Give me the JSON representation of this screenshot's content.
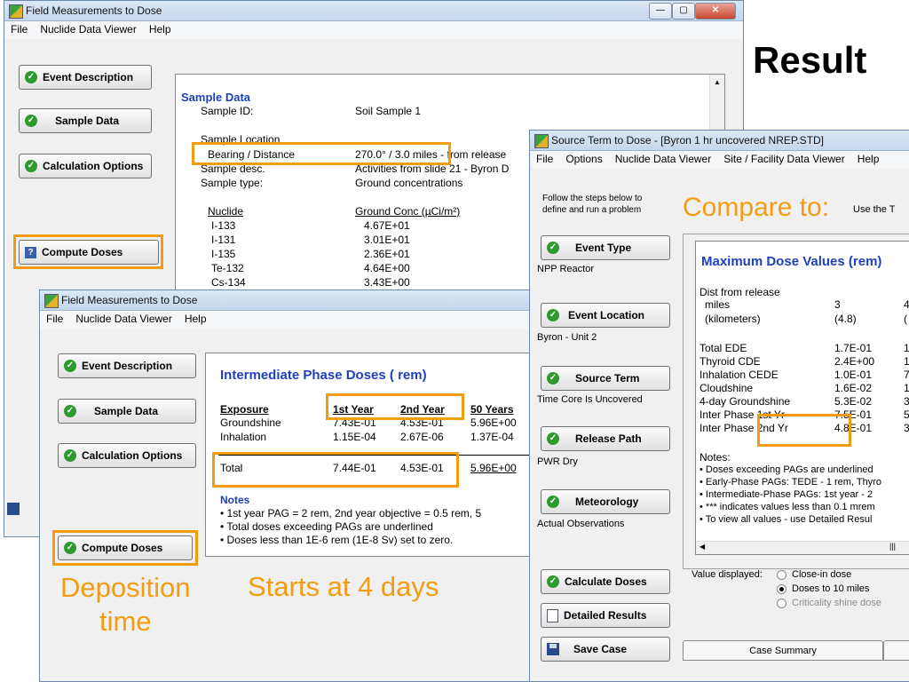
{
  "slide": {
    "heading": "Result",
    "compare": "Compare to:",
    "deposition": "Deposition\ntime",
    "starts": "Starts at 4 days"
  },
  "win1": {
    "title": "Field Measurements to Dose",
    "menu": [
      "File",
      "Nuclide Data Viewer",
      "Help"
    ],
    "buttons": {
      "event_description": "Event Description",
      "sample_data": "Sample Data",
      "calculation_options": "Calculation Options",
      "compute_doses": "Compute Doses"
    },
    "sample": {
      "heading": "Sample Data",
      "rows": [
        {
          "label": "Sample ID:",
          "value": "Soil Sample 1"
        },
        {
          "label": "Sample Location",
          "value": ""
        },
        {
          "label": "Bearing / Distance",
          "value": "270.0° / 3.0 miles - from release"
        },
        {
          "label": "Sample desc.",
          "value": "Activities from slide 21 - Byron D"
        },
        {
          "label": "Sample type:",
          "value": "Ground concentrations"
        }
      ],
      "nuclide_header": "Nuclide",
      "conc_header": "Ground Conc (µCi/m²)",
      "nuclides": [
        {
          "name": "I-133",
          "conc": "4.67E+01"
        },
        {
          "name": "I-131",
          "conc": "3.01E+01"
        },
        {
          "name": "I-135",
          "conc": "2.36E+01"
        },
        {
          "name": "Te-132",
          "conc": "4.64E+00"
        },
        {
          "name": "Cs-134",
          "conc": "3.43E+00"
        }
      ]
    }
  },
  "win2": {
    "title": "Field Measurements to Dose",
    "menu": [
      "File",
      "Nuclide Data Viewer",
      "Help"
    ],
    "buttons": {
      "event_description": "Event Description",
      "sample_data": "Sample Data",
      "calculation_options": "Calculation Options",
      "compute_doses": "Compute Doses"
    },
    "table": {
      "heading": "Intermediate Phase Doses ( rem)",
      "headers": [
        "Exposure",
        "1st Year",
        "2nd Year",
        "50 Years"
      ],
      "rows": [
        [
          "Groundshine",
          "7.43E-01",
          "4.53E-01",
          "5.96E+00"
        ],
        [
          "Inhalation",
          "1.15E-04",
          "2.67E-06",
          "1.37E-04"
        ]
      ],
      "total": [
        "Total",
        "7.44E-01",
        "4.53E-01",
        "5.96E+00"
      ]
    },
    "notes": {
      "heading": "Notes",
      "lines": [
        "• 1st year PAG = 2 rem, 2nd year objective = 0.5 rem, 5",
        "• Total doses exceeding PAGs are underlined",
        "• Doses less than 1E-6 rem (1E-8 Sv) set to zero."
      ]
    }
  },
  "win3": {
    "title": "Source Term to Dose - [Byron 1 hr uncovered NREP.STD]",
    "menu": [
      "File",
      "Options",
      "Nuclide Data Viewer",
      "Site / Facility Data Viewer",
      "Help"
    ],
    "intro": "Follow the steps below to\ndefine and run a problem",
    "use_the": "Use the T",
    "steps": [
      {
        "label": "Event Type",
        "sub": "NPP Reactor"
      },
      {
        "label": "Event Location",
        "sub": "Byron - Unit 2"
      },
      {
        "label": "Source Term",
        "sub": "Time Core Is Uncovered"
      },
      {
        "label": "Release Path",
        "sub": "PWR Dry"
      },
      {
        "label": "Meteorology",
        "sub": "Actual Observations"
      }
    ],
    "calculate_doses": "Calculate Doses",
    "detailed_results": "Detailed Results",
    "save_case": "Save Case",
    "results": {
      "heading": "Maximum Dose Values (rem)",
      "dist_label": "Dist from release",
      "miles_label": "miles",
      "miles_value": "3",
      "km_label": "(kilometers)",
      "km_value": "(4.8)",
      "col2_miles": "4",
      "col2_km": "(",
      "rows": [
        {
          "label": "Total EDE",
          "v1": "1.7E-01",
          "v2": "1"
        },
        {
          "label": "Thyroid CDE",
          "v1": "2.4E+00",
          "v2": "1"
        },
        {
          "label": "Inhalation CEDE",
          "v1": "1.0E-01",
          "v2": "7"
        },
        {
          "label": "Cloudshine",
          "v1": "1.6E-02",
          "v2": "1"
        },
        {
          "label": "4-day Groundshine",
          "v1": "5.3E-02",
          "v2": "3"
        },
        {
          "label": "Inter Phase 1st Yr",
          "v1": "7.5E-01",
          "v2": "5"
        },
        {
          "label": "Inter Phase 2nd Yr",
          "v1": "4.8E-01",
          "v2": "3"
        }
      ],
      "notes_heading": "Notes:",
      "notes": [
        "• Doses exceeding PAGs are underlined",
        "• Early-Phase PAGs: TEDE - 1 rem, Thyro",
        "• Intermediate-Phase PAGs: 1st year - 2",
        "• *** indicates values less than 0.1 mrem",
        "• To view all values - use Detailed Resul"
      ]
    },
    "value_displayed": "Value displayed:",
    "radio_options": [
      "Close-in dose",
      "Doses to 10 miles",
      "Criticality shine dose"
    ],
    "tab": "Case Summary"
  },
  "colors": {
    "highlight": "#f39c12",
    "heading_blue": "#1f3fbf",
    "check_green": "#2e9a2e"
  }
}
